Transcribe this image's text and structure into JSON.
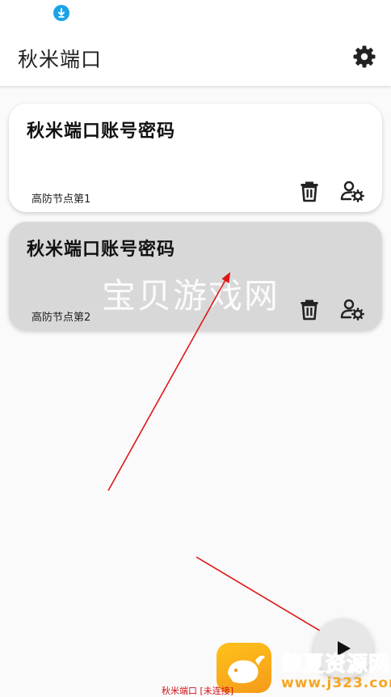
{
  "app_bar": {
    "title": "秋米端口"
  },
  "cards": [
    {
      "title": "秋米端口账号密码",
      "subtitle": "高防节点第1"
    },
    {
      "title": "秋米端口账号密码",
      "subtitle": "高防节点第2"
    }
  ],
  "watermark": "宝贝游戏网",
  "bottom": {
    "status_text": "秋米端口 [未连接]",
    "brand_name": "鲸夏资源网",
    "brand_url": "www.j323.com"
  },
  "colors": {
    "accent_blue": "#1aa3e8",
    "status_red": "#d0121b",
    "arrow_red": "#e01616",
    "brand_orange": "#f6a623",
    "card_selected": "#d8d8d8"
  },
  "icons": [
    "download-icon",
    "gear-icon",
    "trash-icon",
    "user-settings-icon",
    "play-icon",
    "whale-logo-icon"
  ]
}
